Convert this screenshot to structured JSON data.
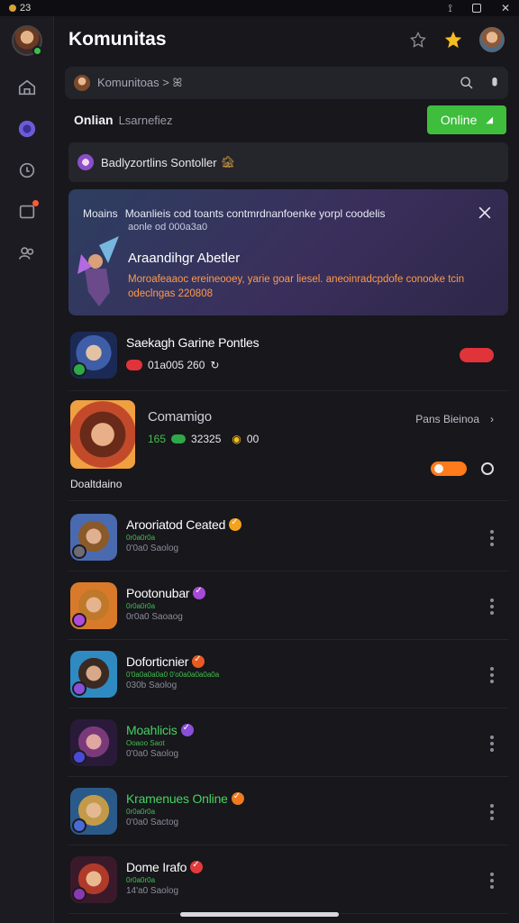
{
  "status_bar": {
    "time": "23"
  },
  "header": {
    "title": "Komunitas"
  },
  "search": {
    "text": "Komunitoas > ꕤ"
  },
  "filter": {
    "label": "Onlian",
    "sub": "Lsarnefiez",
    "button_label": "Online"
  },
  "notice": {
    "text": "Badlyzortlins Sontoller",
    "emoji": "🏚"
  },
  "banner": {
    "head_label": "Moains",
    "head_text": "Moanlieis cod toants contmrdnanfoenke yorpl coodelis",
    "head_sub": "aonle od 000a3a0",
    "title": "Araandihgr Abetler",
    "desc": "Moroafeaaoc ereineooey, yarie goar liesel. aneoinradcpdofe conooke tcin odeclngas 220808"
  },
  "games": [
    {
      "name": "Saekagh Garine Pontles",
      "meta_a": "01a005 260",
      "meta_b": ""
    },
    {
      "name": "Comamigo",
      "right_label": "Pans Bieinoa",
      "meta_a": "165",
      "meta_b": "32325",
      "meta_c": "00",
      "tag": "Doaltdaino"
    }
  ],
  "friends": [
    {
      "name": "Arooriatod Ceated",
      "sub1": "0r0a0r0a",
      "sub2": "0'0a0 Saolog",
      "badge_color": "#f2a21b",
      "name_color": "#ffffff"
    },
    {
      "name": "Pootonubar",
      "sub1": "0r0a0r0a",
      "sub2": "0r0a0 Saoaog",
      "badge_color": "#a749d8",
      "name_color": "#ffffff"
    },
    {
      "name": "Doforticnier",
      "sub1": "0'0a0a0a0a0 0'o0a0a0a0a0a",
      "sub2": "030b Saolog",
      "badge_color": "#e85a20",
      "name_color": "#ffffff"
    },
    {
      "name": "Moahlicis",
      "sub1": "Ooaoo Saot",
      "sub2": "0'0a0 Saolog",
      "badge_color": "#8a4fd8",
      "name_color": "#47d162"
    },
    {
      "name": "Kramenues Online",
      "sub1": "0r0a0r0a",
      "sub2": "0'0a0 Sactog",
      "badge_color": "#f07a1c",
      "name_color": "#47d162"
    },
    {
      "name": "Dome Irafo",
      "sub1": "0r0a0r0a",
      "sub2": "14'a0 Saolog",
      "badge_color": "#e23a3a",
      "name_color": "#ffffff"
    }
  ],
  "icons": {
    "rail": [
      "home-icon",
      "discord-icon",
      "activity-icon",
      "chat-icon",
      "friends-icon"
    ],
    "header": [
      "pin-icon",
      "star-icon"
    ],
    "search": [
      "search-icon",
      "mic-icon"
    ]
  },
  "colors": {
    "accent_green": "#3fbd3c",
    "accent_orange": "#ff7a1a",
    "accent_red": "#e0343a"
  }
}
